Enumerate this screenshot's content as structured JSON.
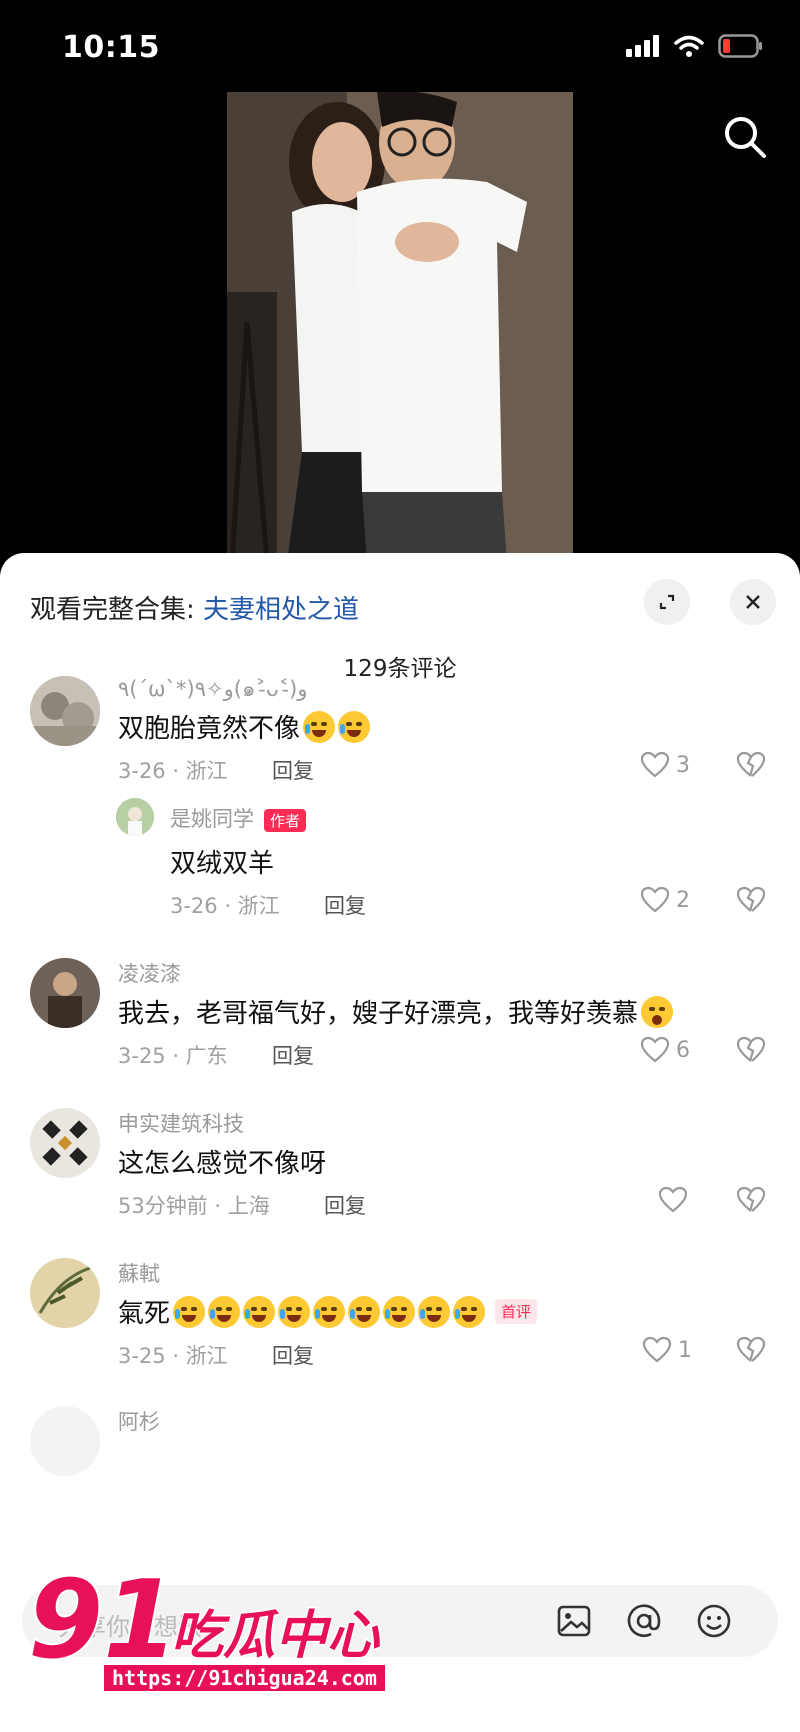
{
  "status_bar": {
    "time": "10:15"
  },
  "sheet": {
    "header_prefix": "观看完整合集: ",
    "collection_name": "夫妻相处之道",
    "comment_count_label": "129条评论"
  },
  "comments": [
    {
      "user": "٩(ˊωˋ*)و✧٩(๑˃̵ᴗ˂̵)و",
      "text": "双胞胎竟然不像",
      "meta": "3-26 · 浙江",
      "reply": "回复",
      "likes": "3"
    },
    {
      "user": "是姚同学",
      "badge": "作者",
      "text": "双绒双羊",
      "meta": "3-26 · 浙江",
      "reply": "回复",
      "likes": "2"
    },
    {
      "user": "凌凌漆",
      "text": "我去，老哥福气好，嫂子好漂亮，我等好羡慕",
      "meta": "3-25 · 广东",
      "reply": "回复",
      "likes": "6"
    },
    {
      "user": "申实建筑科技",
      "text": "这怎么感觉不像呀",
      "meta": "53分钟前 · 上海",
      "reply": "回复",
      "likes": ""
    },
    {
      "user": "蘇軾",
      "text": "氣死",
      "badge": "首评",
      "meta": "3-25 · 浙江",
      "reply": "回复",
      "likes": "1"
    },
    {
      "user": "阿杉"
    }
  ],
  "input": {
    "placeholder": "分享你的想法"
  },
  "watermark": {
    "logo": "91吃瓜中心",
    "url": "https://91chigua24.com"
  }
}
